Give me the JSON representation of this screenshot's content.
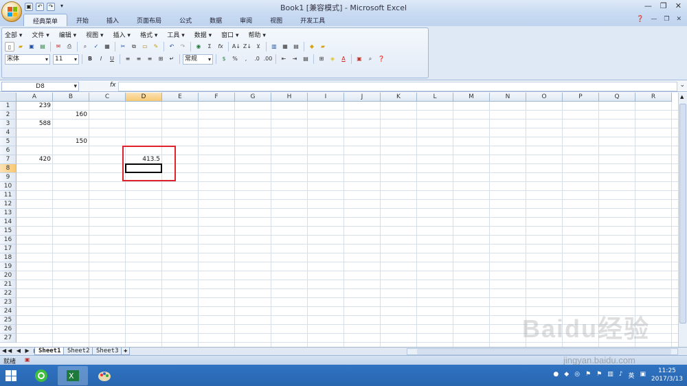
{
  "window": {
    "title": "Book1  [兼容模式] - Microsoft Excel",
    "controls": [
      "—",
      "❐",
      "✕"
    ]
  },
  "ribbon": {
    "tabs": [
      "经典菜单",
      "开始",
      "插入",
      "页面布局",
      "公式",
      "数据",
      "审阅",
      "视图",
      "开发工具"
    ],
    "active_tab": 0
  },
  "classic_menu": {
    "items": [
      "全部 ▾",
      "文件 ▾",
      "编辑 ▾",
      "视图 ▾",
      "插入 ▾",
      "格式 ▾",
      "工具 ▾",
      "数据 ▾",
      "窗口 ▾",
      "帮助 ▾"
    ]
  },
  "format_bar": {
    "font_name": "宋体",
    "font_size": "11",
    "bold": "B",
    "italic": "I",
    "underline": "U",
    "number_format": "常规",
    "percent": "%"
  },
  "formula_bar": {
    "name_box": "D8",
    "fx": "fx",
    "content": ""
  },
  "sheet": {
    "columns": [
      "A",
      "B",
      "C",
      "D",
      "E",
      "F",
      "G",
      "H",
      "I",
      "J",
      "K",
      "L",
      "M",
      "N",
      "O",
      "P",
      "Q",
      "R"
    ],
    "rows": [
      "1",
      "2",
      "3",
      "4",
      "5",
      "6",
      "7",
      "8",
      "9",
      "10",
      "11",
      "12",
      "13",
      "14",
      "15",
      "16",
      "17",
      "18",
      "19",
      "20",
      "21",
      "22",
      "23",
      "24",
      "25",
      "26",
      "27"
    ],
    "selected_column": "D",
    "selected_row": "8",
    "cells": [
      {
        "ref": "A1",
        "value": "239"
      },
      {
        "ref": "B2",
        "value": "160"
      },
      {
        "ref": "A3",
        "value": "588"
      },
      {
        "ref": "B5",
        "value": "150"
      },
      {
        "ref": "A7",
        "value": "420"
      },
      {
        "ref": "D7",
        "value": "413.5"
      }
    ],
    "tabs": [
      "Sheet1",
      "Sheet2",
      "Sheet3"
    ]
  },
  "status": {
    "ready": "就绪"
  },
  "taskbar": {
    "clock_time": "11:25",
    "clock_date": "2017/3/13",
    "ime": "英"
  },
  "watermark": {
    "text": "Baidu经验",
    "url": "jingyan.baidu.com"
  },
  "colors": {
    "highlight_box": "#e0212b",
    "selected_header": "#f7c873",
    "taskbar": "#2a66b0"
  }
}
